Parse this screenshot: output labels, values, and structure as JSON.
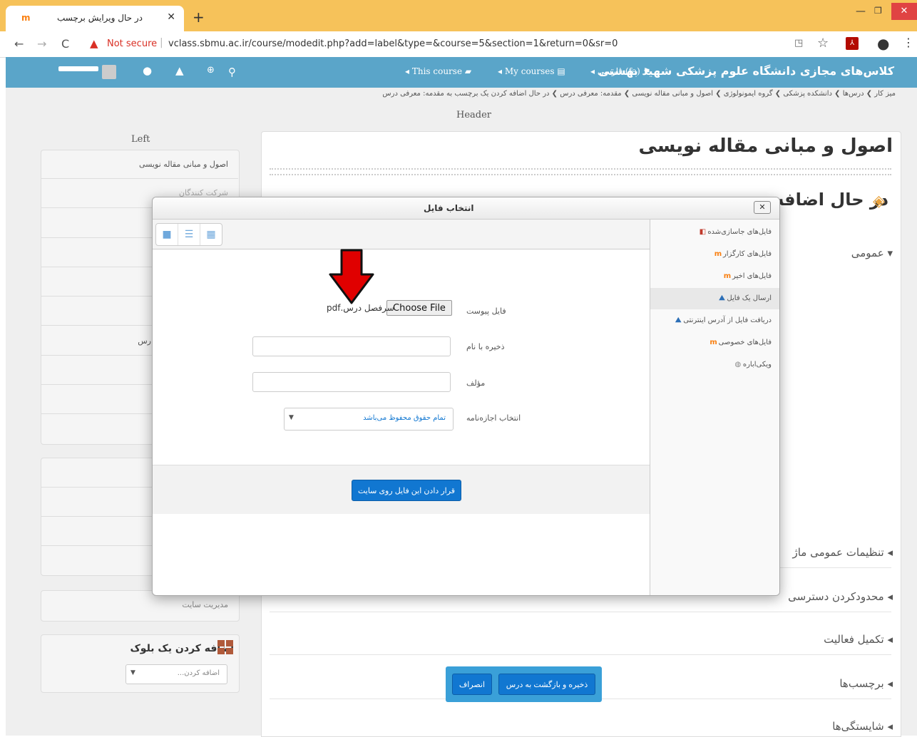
{
  "browser": {
    "tab_title": "در حال ویرایش برچسب",
    "favicon": "m",
    "not_secure": "Not secure",
    "url": "vclass.sbmu.ac.ir/course/modedit.php?add=label&type=&course=5&section=1&return=0&sr=0"
  },
  "navbar": {
    "site_name": "کلاس‌های مجازی دانشگاه علوم پزشکی شهید بهشتی",
    "lang": "فارسی ‎(fa)",
    "my_courses": "My courses",
    "this_course": "This course"
  },
  "page": {
    "breadcrumb": "میز کار ❯ درس‌ها ❯ دانشکده پزشکی ❯ گروه ایمونولوژی ❯ اصول و مبانی مقاله نویسی ❯ مقدمه: معرفی درس ❯ در حال اضافه کردن یک برچسب به مقدمه: معرفی درس",
    "header_label": "Header",
    "left_label": "Left",
    "course_title": "اصول و مبانی مقاله نویسی",
    "editing_title": "در حال اضافه",
    "sections": [
      "عمومی",
      "تنظیمات عمومی ماژ",
      "محدودکردن دسترسی",
      "تکمیل فعالیت",
      "برچسب‌ها",
      "شایستگی‌ها"
    ],
    "left_items": [
      "اصول و مبانی مقاله نویسی",
      "شرکت کنندگان",
      "رس"
    ],
    "site_admin": "مدیریت سایت",
    "add_block_title": "اضافه کردن یک بلوک",
    "add_block_placeholder": "اضافه کردن...",
    "save_return": "ذخیره و بازگشت به درس",
    "cancel": "انصراف"
  },
  "filepicker": {
    "title": "انتخاب فایل",
    "repositories": [
      {
        "icon": "attachment-icon",
        "label": "فایل‌های جاسازی‌شده"
      },
      {
        "icon": "moodle-icon",
        "label": "فایل‌های کارگزار"
      },
      {
        "icon": "moodle-icon",
        "label": "فایل‌های اخیر"
      },
      {
        "icon": "upload-icon",
        "label": "ارسال یک فایل"
      },
      {
        "icon": "url-icon",
        "label": "دریافت فایل از آدرس اینترنتی"
      },
      {
        "icon": "moodle-icon",
        "label": "فایل‌های خصوصی"
      },
      {
        "icon": "wiki-icon",
        "label": "ویکی‌اباره"
      }
    ],
    "attachment_label": "فایل پیوست",
    "choose_file": "Choose File",
    "file_name": "سرفصل درس.pdf",
    "save_as_label": "ذخیره با نام",
    "author_label": "مؤلف",
    "license_label": "انتخاب اجازه‌نامه",
    "license_value": "تمام حقوق محفوظ می‌باشد",
    "upload_button": "قرار دادن این فایل روی سایت"
  },
  "colors": {
    "navbar": "#5aa5c9",
    "primary_button": "#1177d1",
    "annotation_arrow": "#e00000",
    "tabbar": "#f6c25a"
  }
}
